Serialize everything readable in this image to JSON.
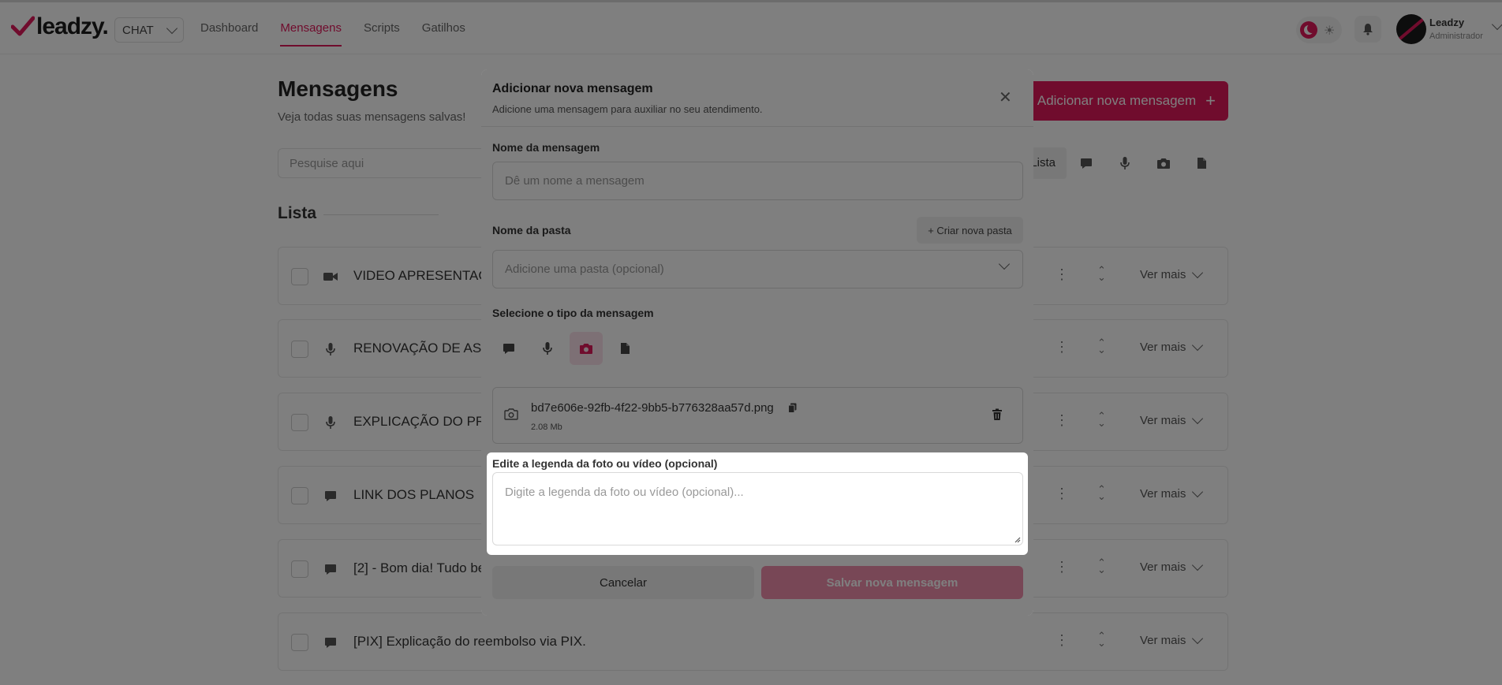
{
  "app": {
    "logo_text": "leadzy.",
    "channel_select": "CHAT",
    "nav": [
      {
        "label": "Dashboard"
      },
      {
        "label": "Mensagens"
      },
      {
        "label": "Scripts"
      },
      {
        "label": "Gatilhos"
      }
    ],
    "active_nav": "Mensagens",
    "user": {
      "name": "Leadzy",
      "role": "Administrador"
    },
    "accent_color": "#e0185b"
  },
  "page": {
    "title": "Mensagens",
    "subtitle": "Veja todas suas mensagens salvas!",
    "add_button": "Adicionar nova mensagem",
    "search_placeholder": "Pesquise aqui",
    "filter_list_label": "Lista",
    "section_title": "Lista",
    "rows": [
      {
        "title": "VIDEO APRESENTAÇÃ",
        "type_icon": "video-icon",
        "more": "Ver mais"
      },
      {
        "title": "RENOVAÇÃO DE ASS",
        "type_icon": "mic-icon",
        "more": "Ver mais"
      },
      {
        "title": "EXPLICAÇÃO DO PRO",
        "type_icon": "mic-icon",
        "more": "Ver mais"
      },
      {
        "title": "LINK DOS PLANOS",
        "type_icon": "chat-icon",
        "more": "Ver mais"
      },
      {
        "title": "[2] - Bom dia! Tudo be",
        "type_icon": "chat-icon",
        "more": "Ver mais"
      },
      {
        "title": "[PIX] Explicação do reembolso via PIX.",
        "type_icon": "chat-icon",
        "more": "Ver mais"
      }
    ]
  },
  "modal": {
    "title": "Adicionar nova mensagem",
    "subtitle": "Adicione uma mensagem para auxiliar no seu atendimento.",
    "name_label": "Nome da mensagem",
    "name_placeholder": "Dê um nome a mensagem",
    "folder_label": "Nome da pasta",
    "new_folder_button": "+ Criar nova pasta",
    "folder_placeholder": "Adicione uma pasta (opcional)",
    "type_label": "Selecione o tipo da mensagem",
    "types": [
      "text",
      "audio",
      "image",
      "document"
    ],
    "selected_type": "image",
    "file": {
      "name": "bd7e606e-92fb-4f22-9bb5-b776328aa57d.png",
      "size": "2.08 Mb"
    },
    "caption_label": "Edite a legenda da foto ou vídeo (opcional)",
    "caption_placeholder": "Digite a legenda da foto ou vídeo (opcional)...",
    "cancel_button": "Cancelar",
    "save_button": "Salvar nova mensagem"
  }
}
